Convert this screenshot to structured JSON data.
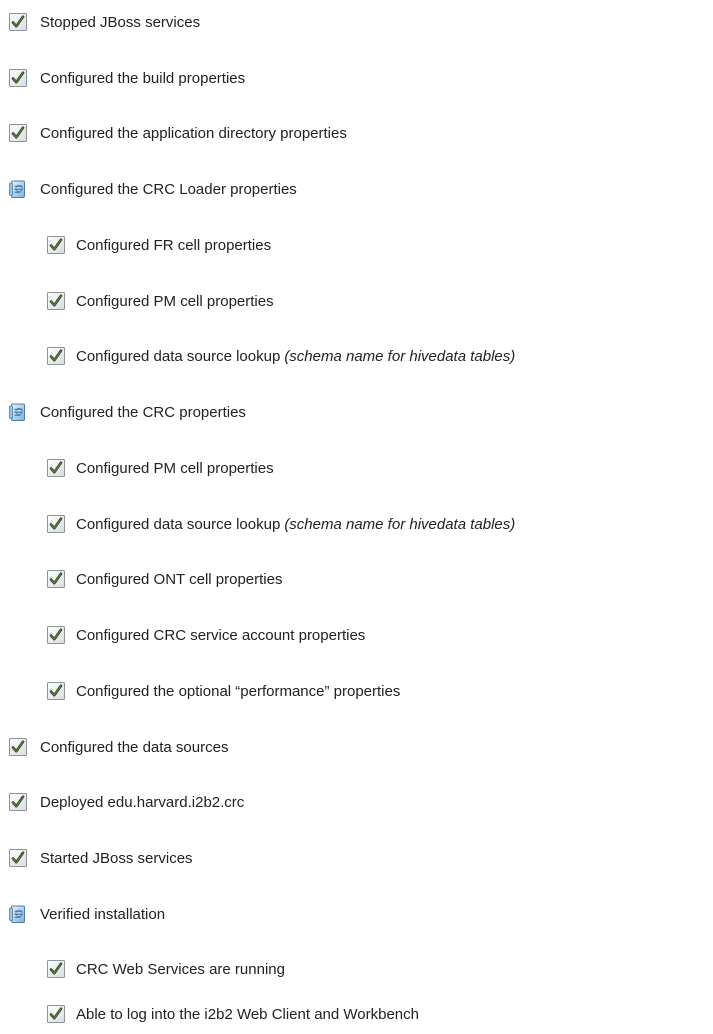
{
  "checklist": [
    {
      "icon": "checkbox-checked-icon",
      "level": 0,
      "label": "Stopped JBoss services"
    },
    {
      "icon": "checkbox-checked-icon",
      "level": 0,
      "label": "Configured the build properties"
    },
    {
      "icon": "checkbox-checked-icon",
      "level": 0,
      "label": "Configured the application directory properties"
    },
    {
      "icon": "task-group-icon",
      "level": 0,
      "label": "Configured the CRC Loader properties"
    },
    {
      "icon": "checkbox-checked-icon",
      "level": 1,
      "label": "Configured FR cell properties"
    },
    {
      "icon": "checkbox-checked-icon",
      "level": 1,
      "label": "Configured PM cell properties"
    },
    {
      "icon": "checkbox-checked-icon",
      "level": 1,
      "label": "Configured data source lookup",
      "note": "(schema name for hivedata tables)"
    },
    {
      "icon": "task-group-icon",
      "level": 0,
      "label": "Configured the CRC properties"
    },
    {
      "icon": "checkbox-checked-icon",
      "level": 1,
      "label": "Configured PM cell properties"
    },
    {
      "icon": "checkbox-checked-icon",
      "level": 1,
      "label": "Configured data source lookup",
      "note": "(schema name for hivedata tables)"
    },
    {
      "icon": "checkbox-checked-icon",
      "level": 1,
      "label": "Configured ONT cell properties"
    },
    {
      "icon": "checkbox-checked-icon",
      "level": 1,
      "label": "Configured CRC service account properties"
    },
    {
      "icon": "checkbox-checked-icon",
      "level": 1,
      "label": "Configured the optional “performance” properties"
    },
    {
      "icon": "checkbox-checked-icon",
      "level": 0,
      "label": "Configured the data sources"
    },
    {
      "icon": "checkbox-checked-icon",
      "level": 0,
      "label": "Deployed edu.harvard.i2b2.crc"
    },
    {
      "icon": "checkbox-checked-icon",
      "level": 0,
      "label": "Started JBoss services"
    },
    {
      "icon": "task-group-icon",
      "level": 0,
      "label": "Verified installation"
    },
    {
      "icon": "checkbox-checked-icon",
      "level": 1,
      "label": "CRC Web Services are running"
    },
    {
      "icon": "checkbox-checked-icon",
      "level": 1,
      "label": "Able to log into the i2b2 Web Client and Workbench"
    }
  ]
}
